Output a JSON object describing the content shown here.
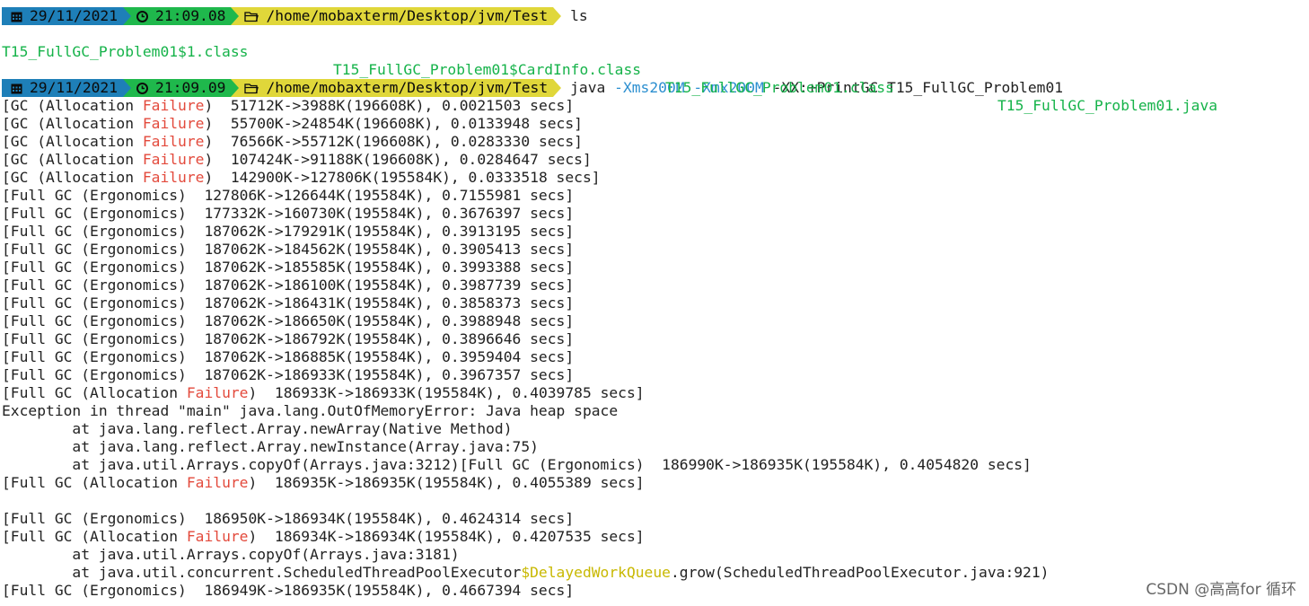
{
  "prompts": [
    {
      "date": "29/11/2021",
      "time": "21:09.08",
      "path": "/home/mobaxterm/Desktop/jvm/Test",
      "command": "ls"
    },
    {
      "date": "29/11/2021",
      "time": "21:09.09",
      "path": "/home/mobaxterm/Desktop/jvm/Test",
      "command_prefix": "java ",
      "opt1": "-Xms200M",
      "opt2": "-Xmx200M",
      "command_suffix": " -XX:+PrintGC T15_FullGC_Problem01"
    }
  ],
  "ls_files": [
    "T15_FullGC_Problem01$1.class",
    "T15_FullGC_Problem01$CardInfo.class",
    "T15_FullGC_Problem01.class",
    "T15_FullGC_Problem01.java"
  ],
  "output": {
    "l1a": "[GC (Allocation ",
    "l1b": "Failure",
    "l1c": ")  51712K->3988K(196608K), 0.0021503 secs]",
    "l2a": "[GC (Allocation ",
    "l2b": "Failure",
    "l2c": ")  55700K->24854K(196608K), 0.0133948 secs]",
    "l3a": "[GC (Allocation ",
    "l3b": "Failure",
    "l3c": ")  76566K->55712K(196608K), 0.0283330 secs]",
    "l4a": "[GC (Allocation ",
    "l4b": "Failure",
    "l4c": ")  107424K->91188K(196608K), 0.0284647 secs]",
    "l5a": "[GC (Allocation ",
    "l5b": "Failure",
    "l5c": ")  142900K->127806K(195584K), 0.0333518 secs]",
    "l6": "[Full GC (Ergonomics)  127806K->126644K(195584K), 0.7155981 secs]",
    "l7": "[Full GC (Ergonomics)  177332K->160730K(195584K), 0.3676397 secs]",
    "l8": "[Full GC (Ergonomics)  187062K->179291K(195584K), 0.3913195 secs]",
    "l9": "[Full GC (Ergonomics)  187062K->184562K(195584K), 0.3905413 secs]",
    "l10": "[Full GC (Ergonomics)  187062K->185585K(195584K), 0.3993388 secs]",
    "l11": "[Full GC (Ergonomics)  187062K->186100K(195584K), 0.3987739 secs]",
    "l12": "[Full GC (Ergonomics)  187062K->186431K(195584K), 0.3858373 secs]",
    "l13": "[Full GC (Ergonomics)  187062K->186650K(195584K), 0.3988948 secs]",
    "l14": "[Full GC (Ergonomics)  187062K->186792K(195584K), 0.3896646 secs]",
    "l15": "[Full GC (Ergonomics)  187062K->186885K(195584K), 0.3959404 secs]",
    "l16": "[Full GC (Ergonomics)  187062K->186933K(195584K), 0.3967357 secs]",
    "l17a": "[Full GC (Allocation ",
    "l17b": "Failure",
    "l17c": ")  186933K->186933K(195584K), 0.4039785 secs]",
    "l18": "Exception in thread \"main\" java.lang.OutOfMemoryError: Java heap space",
    "l19": "        at java.lang.reflect.Array.newArray(Native Method)",
    "l20": "        at java.lang.reflect.Array.newInstance(Array.java:75)",
    "l21": "        at java.util.Arrays.copyOf(Arrays.java:3212)[Full GC (Ergonomics)  186990K->186935K(195584K), 0.4054820 secs]",
    "l22a": "[Full GC (Allocation ",
    "l22b": "Failure",
    "l22c": ")  186935K->186935K(195584K), 0.4055389 secs]",
    "l23": "[Full GC (Ergonomics)  186950K->186934K(195584K), 0.4624314 secs]",
    "l24a": "[Full GC (Allocation ",
    "l24b": "Failure",
    "l24c": ")  186934K->186934K(195584K), 0.4207535 secs]",
    "l25": "        at java.util.Arrays.copyOf(Arrays.java:3181)",
    "l26a": "        at java.util.concurrent.ScheduledThreadPoolExecutor",
    "l26b": "$DelayedWorkQueue",
    "l26c": ".grow(ScheduledThreadPoolExecutor.java:921)",
    "l27": "[Full GC (Ergonomics)  186949K->186935K(195584K), 0.4667394 secs]"
  },
  "watermark": "CSDN @高高for 循环",
  "icons": [
    "calendar-icon",
    "clock-icon",
    "folder-icon"
  ],
  "colors": {
    "date_bg": "#1e7fb8",
    "time_bg": "#1fb84c",
    "path_bg": "#e0d73a",
    "file": "#16b34a",
    "failure": "#e34a3c",
    "option": "#2c8fd0"
  }
}
